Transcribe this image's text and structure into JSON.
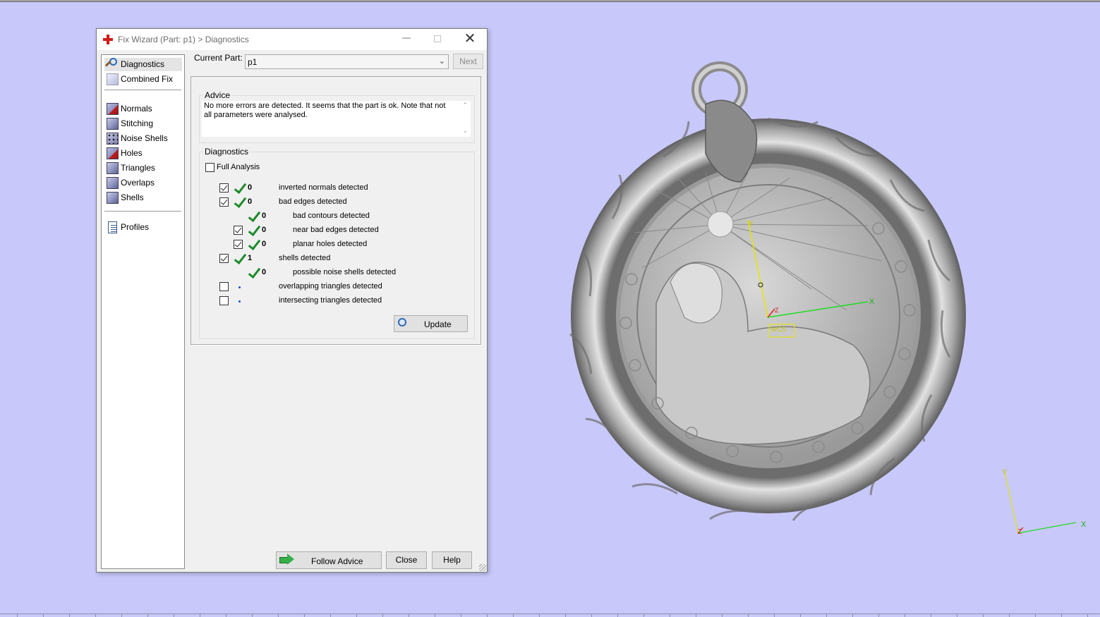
{
  "window": {
    "title": "Fix Wizard (Part: p1) > Diagnostics",
    "minimize_glyph": "─",
    "close_glyph": "✕"
  },
  "nav": {
    "items": [
      {
        "label": "Diagnostics",
        "icon": "magnifier-icon"
      },
      {
        "label": "Combined Fix",
        "icon": "combined-fix-icon"
      },
      {
        "label": "Normals",
        "icon": "normals-icon"
      },
      {
        "label": "Stitching",
        "icon": "stitching-icon"
      },
      {
        "label": "Noise Shells",
        "icon": "noise-shells-icon"
      },
      {
        "label": "Holes",
        "icon": "holes-icon"
      },
      {
        "label": "Triangles",
        "icon": "triangles-icon"
      },
      {
        "label": "Overlaps",
        "icon": "overlaps-icon"
      },
      {
        "label": "Shells",
        "icon": "shells-icon"
      },
      {
        "label": "Profiles",
        "icon": "profiles-icon"
      }
    ],
    "selected": "Diagnostics"
  },
  "current_part": {
    "label": "Current Part:",
    "value": "p1",
    "next_label": "Next"
  },
  "advice": {
    "title": "Advice",
    "text": "No more errors are detected. It seems that the part is ok. Note that not all parameters were analysed."
  },
  "diagnostics": {
    "title": "Diagnostics",
    "full_analysis_label": "Full Analysis",
    "full_analysis_checked": false,
    "rows": [
      {
        "count": "0",
        "label": "inverted normals detected",
        "checked": true,
        "status": "ok"
      },
      {
        "count": "0",
        "label": "bad edges detected",
        "checked": true,
        "status": "ok"
      },
      {
        "count": "0",
        "label": "bad contours detected",
        "status": "ok"
      },
      {
        "count": "0",
        "label": "near bad edges detected",
        "checked": true,
        "status": "ok"
      },
      {
        "count": "0",
        "label": "planar holes detected",
        "checked": true,
        "status": "ok"
      },
      {
        "count": "1",
        "label": "shells detected",
        "checked": true,
        "status": "ok"
      },
      {
        "count": "0",
        "label": "possible noise shells detected",
        "status": "ok"
      },
      {
        "count": "",
        "label": "overlapping triangles detected",
        "checked": false,
        "status": "not-analysed"
      },
      {
        "count": "",
        "label": "intersecting triangles detected",
        "checked": false,
        "status": "not-analysed"
      }
    ],
    "update_label": "Update"
  },
  "footer": {
    "follow_advice_label": "Follow Advice",
    "close_label": "Close",
    "help_label": "Help"
  },
  "viewport": {
    "background_color": "#c8c8fa",
    "model_axis_labels": {
      "x": "X",
      "y": "Y",
      "z": "Z"
    },
    "corner_axis_labels": {
      "x": "X",
      "y": "Y",
      "z": "Z"
    },
    "origin_tag": "WCS"
  }
}
